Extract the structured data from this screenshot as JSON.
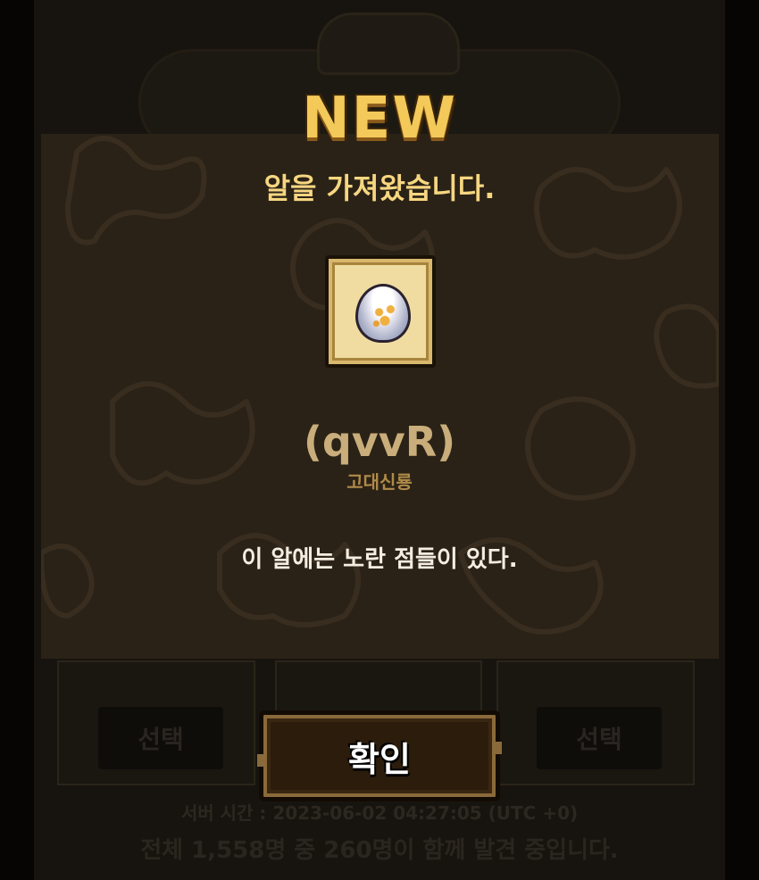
{
  "background": {
    "select_labels": [
      "선택",
      "선택"
    ],
    "server_time": "서버 시간 : 2023-06-02 04:27:05 (UTC +0)",
    "participants": "전체 1,558명 중 260명이 함께 발견 중입니다."
  },
  "modal": {
    "badge": "NEW",
    "headline": "알을 가져왔습니다.",
    "egg": {
      "icon": "egg-icon",
      "name": "(qvvR)",
      "species": "고대신룡",
      "description": "이 알에는 노란 점들이 있다."
    },
    "confirm_label": "확인"
  },
  "colors": {
    "title": "#f3c95a",
    "headline": "#f6d680",
    "panel": "#2a2217",
    "name": "#c9ad7a",
    "species": "#b08a48"
  }
}
